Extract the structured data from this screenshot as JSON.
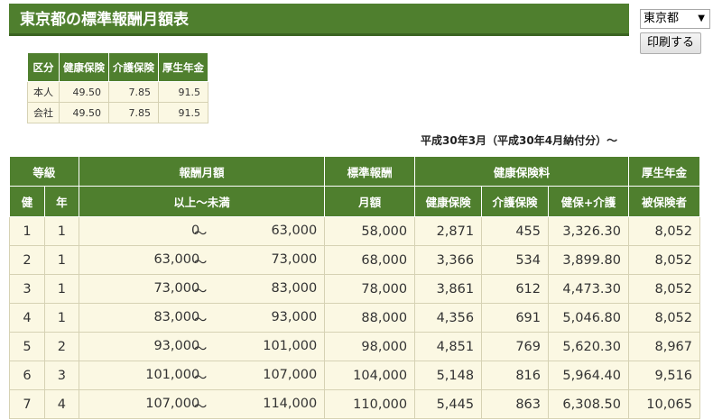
{
  "title": "東京都の標準報酬月額表",
  "prefecture_select": {
    "value": "東京都"
  },
  "print_button": "印刷する",
  "rates": {
    "headers": [
      "区分",
      "健康保険",
      "介護保険",
      "厚生年金"
    ],
    "rows": [
      [
        "本人",
        "49.50",
        "7.85",
        "91.5"
      ],
      [
        "会社",
        "49.50",
        "7.85",
        "91.5"
      ]
    ]
  },
  "period": "平成30年3月（平成30年4月納付分）～",
  "grade_table": {
    "group_headers": {
      "grade": "等級",
      "monthly_pay": "報酬月額",
      "standard": "標準報酬",
      "health": "健康保険料",
      "pension": "厚生年金"
    },
    "sub_headers": {
      "ken": "健",
      "nen": "年",
      "range": "以上～未満",
      "monthly": "月額",
      "health_ins": "健康保険",
      "care_ins": "介護保険",
      "health_care": "健保+介護",
      "insured": "被保険者"
    },
    "tilde": "～",
    "rows": [
      [
        "1",
        "1",
        "0",
        "63,000",
        "58,000",
        "2,871",
        "455",
        "3,326.30",
        "8,052"
      ],
      [
        "2",
        "1",
        "63,000",
        "73,000",
        "68,000",
        "3,366",
        "534",
        "3,899.80",
        "8,052"
      ],
      [
        "3",
        "1",
        "73,000",
        "83,000",
        "78,000",
        "3,861",
        "612",
        "4,473.30",
        "8,052"
      ],
      [
        "4",
        "1",
        "83,000",
        "93,000",
        "88,000",
        "4,356",
        "691",
        "5,046.80",
        "8,052"
      ],
      [
        "5",
        "2",
        "93,000",
        "101,000",
        "98,000",
        "4,851",
        "769",
        "5,620.30",
        "8,967"
      ],
      [
        "6",
        "3",
        "101,000",
        "107,000",
        "104,000",
        "5,148",
        "816",
        "5,964.40",
        "9,516"
      ],
      [
        "7",
        "4",
        "107,000",
        "114,000",
        "110,000",
        "5,445",
        "863",
        "6,308.50",
        "10,065"
      ]
    ]
  }
}
